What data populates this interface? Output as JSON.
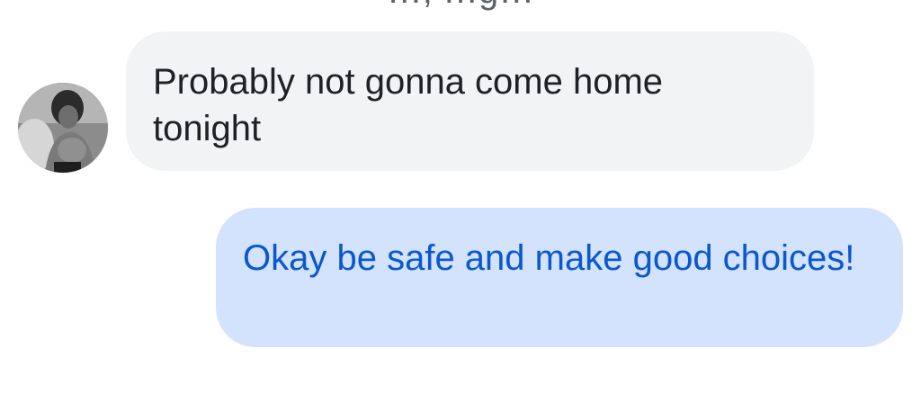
{
  "conversation": {
    "previous_message_fragment": "…, …g…",
    "messages": [
      {
        "direction": "incoming",
        "text": "Probably not gonna come home tonight",
        "avatar_icon": "contact-photo"
      },
      {
        "direction": "outgoing",
        "text": "Okay be safe and make good choices!"
      }
    ]
  },
  "colors": {
    "incoming_bubble": "#f1f3f4",
    "incoming_text": "#202124",
    "outgoing_bubble": "#d3e3fd",
    "outgoing_text": "#0b57d0"
  }
}
